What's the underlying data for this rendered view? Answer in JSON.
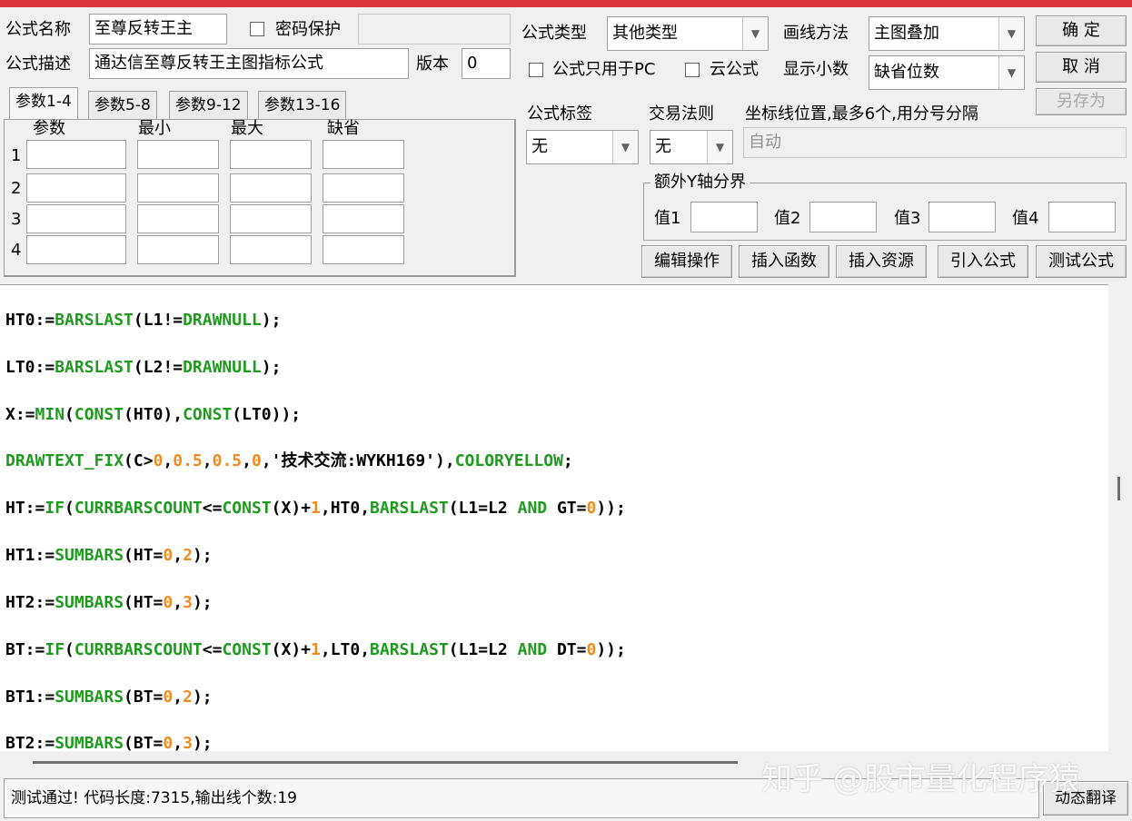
{
  "title_bar": {
    "accent": "#d9353a"
  },
  "form": {
    "name_label": "公式名称",
    "name_value": "至尊反转王主",
    "password_label": "密码保护",
    "desc_label": "公式描述",
    "desc_value": "通达信至尊反转王主图指标公式",
    "version_label": "版本",
    "version_value": "0",
    "type_label": "公式类型",
    "type_value": "其他类型",
    "draw_label": "画线方法",
    "draw_value": "主图叠加",
    "pc_only_label": "公式只用于PC",
    "cloud_label": "云公式",
    "decimal_label": "显示小数",
    "decimal_value": "缺省位数",
    "ok_label": "确  定",
    "cancel_label": "取  消",
    "saveas_label": "另存为",
    "tag_label": "公式标签",
    "tag_value": "无",
    "rule_label": "交易法则",
    "rule_value": "无",
    "coord_label": "坐标线位置,最多6个,用分号分隔",
    "coord_value": "自动",
    "yaxis_label": "额外Y轴分界",
    "val1": "值1",
    "val2": "值2",
    "val3": "值3",
    "val4": "值4"
  },
  "tabs": [
    "参数1-4",
    "参数5-8",
    "参数9-12",
    "参数13-16"
  ],
  "params": {
    "headers": [
      "参数",
      "最小",
      "最大",
      "缺省"
    ],
    "rows": [
      "1",
      "2",
      "3",
      "4"
    ]
  },
  "actions": [
    "编辑操作",
    "插入函数",
    "插入资源",
    "引入公式",
    "测试公式"
  ],
  "status": {
    "message": "测试通过! 代码长度:7315,输出线个数:19",
    "dynamic_label": "动态翻译"
  },
  "watermark": "知乎 @股市量化程序猿",
  "code_lines": [
    [
      [
        "HT0:=",
        ""
      ],
      [
        "BARSLAST",
        "fn"
      ],
      [
        "(L1!=",
        ""
      ],
      [
        "DRAWNULL",
        "fn"
      ],
      [
        ");",
        ""
      ]
    ],
    [
      [
        "LT0:=",
        ""
      ],
      [
        "BARSLAST",
        "fn"
      ],
      [
        "(L2!=",
        ""
      ],
      [
        "DRAWNULL",
        "fn"
      ],
      [
        ");",
        ""
      ]
    ],
    [
      [
        "X:=",
        ""
      ],
      [
        "MIN",
        "fn"
      ],
      [
        "(",
        ""
      ],
      [
        "CONST",
        "fn"
      ],
      [
        "(HT0),",
        ""
      ],
      [
        "CONST",
        "fn"
      ],
      [
        "(LT0));",
        ""
      ]
    ],
    [
      [
        "DRAWTEXT_FIX",
        "fn"
      ],
      [
        "(C>",
        ""
      ],
      [
        "0",
        "num"
      ],
      [
        ",",
        ""
      ],
      [
        "0.5",
        "num"
      ],
      [
        ",",
        ""
      ],
      [
        "0.5",
        "num"
      ],
      [
        ",",
        ""
      ],
      [
        "0",
        "num"
      ],
      [
        ",'技术交流:WYKH169'),",
        ""
      ],
      [
        "COLORYELLOW",
        "fn"
      ],
      [
        ";",
        ""
      ]
    ],
    [
      [
        "HT:=",
        ""
      ],
      [
        "IF",
        "fn"
      ],
      [
        "(",
        ""
      ],
      [
        "CURRBARSCOUNT",
        "fn"
      ],
      [
        "<=",
        ""
      ],
      [
        "CONST",
        "fn"
      ],
      [
        "(X)+",
        ""
      ],
      [
        "1",
        "num"
      ],
      [
        ",HT0,",
        ""
      ],
      [
        "BARSLAST",
        "fn"
      ],
      [
        "(L1=L2 ",
        ""
      ],
      [
        "AND",
        "kw"
      ],
      [
        " GT=",
        ""
      ],
      [
        "0",
        "num"
      ],
      [
        "));",
        ""
      ]
    ],
    [
      [
        "HT1:=",
        ""
      ],
      [
        "SUMBARS",
        "fn"
      ],
      [
        "(HT=",
        ""
      ],
      [
        "0",
        "num"
      ],
      [
        ",",
        ""
      ],
      [
        "2",
        "num"
      ],
      [
        ");",
        ""
      ]
    ],
    [
      [
        "HT2:=",
        ""
      ],
      [
        "SUMBARS",
        "fn"
      ],
      [
        "(HT=",
        ""
      ],
      [
        "0",
        "num"
      ],
      [
        ",",
        ""
      ],
      [
        "3",
        "num"
      ],
      [
        ");",
        ""
      ]
    ],
    [
      [
        "BT:=",
        ""
      ],
      [
        "IF",
        "fn"
      ],
      [
        "(",
        ""
      ],
      [
        "CURRBARSCOUNT",
        "fn"
      ],
      [
        "<=",
        ""
      ],
      [
        "CONST",
        "fn"
      ],
      [
        "(X)+",
        ""
      ],
      [
        "1",
        "num"
      ],
      [
        ",LT0,",
        ""
      ],
      [
        "BARSLAST",
        "fn"
      ],
      [
        "(L1=L2 ",
        ""
      ],
      [
        "AND",
        "kw"
      ],
      [
        " DT=",
        ""
      ],
      [
        "0",
        "num"
      ],
      [
        "));",
        ""
      ]
    ],
    [
      [
        "BT1:=",
        ""
      ],
      [
        "SUMBARS",
        "fn"
      ],
      [
        "(BT=",
        ""
      ],
      [
        "0",
        "num"
      ],
      [
        ",",
        ""
      ],
      [
        "2",
        "num"
      ],
      [
        ");",
        ""
      ]
    ],
    [
      [
        "BT2:=",
        ""
      ],
      [
        "SUMBARS",
        "fn"
      ],
      [
        "(BT=",
        ""
      ],
      [
        "0",
        "num"
      ],
      [
        ",",
        ""
      ],
      [
        "3",
        "num"
      ],
      [
        ");",
        ""
      ]
    ]
  ]
}
